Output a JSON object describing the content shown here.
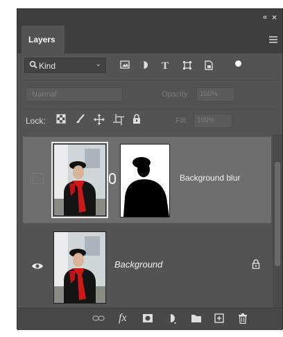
{
  "header": {
    "collapse_glyph": "«",
    "close_glyph": "×"
  },
  "tabs": [
    {
      "label": "Layers"
    }
  ],
  "filter": {
    "kind_label": "Kind",
    "search_icon": "search-icon",
    "chevron": "⌄",
    "icons": [
      "image-filter-icon",
      "adjustment-filter-icon",
      "type-filter-icon",
      "shape-filter-icon",
      "smart-object-filter-icon"
    ]
  },
  "blend": {
    "mode": "Normal",
    "opacity_label": "Opacity:",
    "opacity_value": "100%"
  },
  "lock": {
    "label": "Lock:",
    "fill_label": "Fill:",
    "fill_value": "100%"
  },
  "layers": [
    {
      "name": "Background blur",
      "visible": false,
      "has_mask": true,
      "selected": true
    },
    {
      "name": "Background",
      "visible": true,
      "locked": true
    }
  ],
  "bottom": {
    "fx_label": "fx"
  },
  "colors": {
    "panel": "#535353",
    "selected_row": "#6e6e6e",
    "chrome": "#3e3e3e"
  }
}
